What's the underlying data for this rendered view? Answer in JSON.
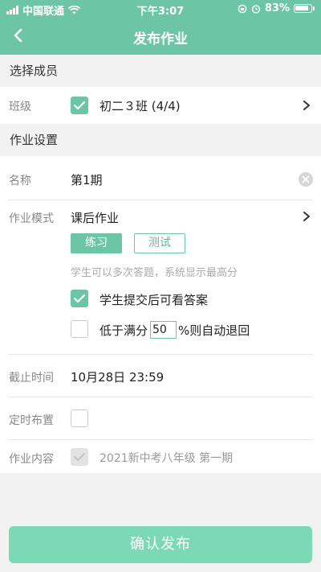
{
  "status_bar": {
    "carrier": "中国联通",
    "time": "下午3:07",
    "battery": "83%"
  },
  "nav": {
    "title": "发布作业"
  },
  "members_section": {
    "header": "选择成员",
    "class_label": "班级",
    "class_value": "初二３班 (4/4)",
    "class_checked": true
  },
  "settings_section": {
    "header": "作业设置",
    "name_label": "名称",
    "name_value": "第1期",
    "mode_label": "作业模式",
    "mode_value": "课后作业",
    "chips": [
      {
        "label": "练习",
        "active": true
      },
      {
        "label": "测试",
        "active": false
      }
    ],
    "hint": "学生可以多次答题，系统显示最高分",
    "option_view_answer": {
      "label": "学生提交后可看答案",
      "checked": true
    },
    "option_auto_return": {
      "prefix": "低于满分",
      "percent_value": "50",
      "suffix": "%则自动退回",
      "checked": false
    },
    "deadline_label": "截止时间",
    "deadline_value": "10月28日 23:59",
    "scheduled_label": "定时布置",
    "scheduled_checked": false,
    "content_label": "作业内容",
    "content_value": "2021新中考八年级 第一期",
    "content_checked": true
  },
  "footer": {
    "submit_label": "确认发布"
  },
  "colors": {
    "accent": "#6cc6a5",
    "button": "#7bd9b5",
    "background": "#f2f2f2"
  }
}
